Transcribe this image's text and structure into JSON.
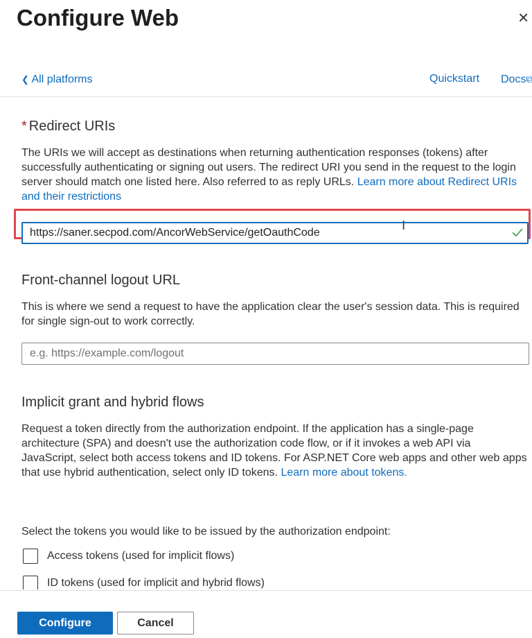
{
  "header": {
    "title": "Configure Web",
    "close_glyph": "×"
  },
  "nav": {
    "back_glyph": "❮",
    "back_label": "All platforms",
    "quickstart_label": "Quickstart",
    "docs_label": "Docs",
    "docs_icon_glyph": "⧉"
  },
  "redirect": {
    "required_marker": "*",
    "heading": "Redirect URIs",
    "description": "The URIs we will accept as destinations when returning authentication responses (tokens) after successfully authenticating or signing out users. The redirect URI you send in the request to the login server should match one listed here. Also referred to as reply URLs.",
    "learn_more": "Learn more about Redirect URIs and their restrictions",
    "uri_value": "https://saner.secpod.com/AncorWebService/getOauthCode",
    "valid_icon": "checkmark-icon",
    "cursor_glyph": "I"
  },
  "logout": {
    "heading": "Front-channel logout URL",
    "description": "This is where we send a request to have the application clear the user's session data. This is required for single sign-out to work correctly.",
    "placeholder": "e.g. https://example.com/logout"
  },
  "implicit": {
    "heading": "Implicit grant and hybrid flows",
    "description": "Request a token directly from the authorization endpoint. If the application has a single-page architecture (SPA) and doesn't use the authorization code flow, or if it invokes a web API via JavaScript, select both access tokens and ID tokens. For ASP.NET Core web apps and other web apps that use hybrid authentication, select only ID tokens.",
    "learn_more": "Learn more about tokens.",
    "select_prompt": "Select the tokens you would like to be issued by the authorization endpoint:",
    "access_tokens_label": "Access tokens (used for implicit flows)",
    "id_tokens_label": "ID tokens (used for implicit and hybrid flows)"
  },
  "footer": {
    "configure_label": "Configure",
    "cancel_label": "Cancel"
  },
  "colors": {
    "accent": "#0f6cbd",
    "highlight": "#e0474c",
    "valid": "#3c9b3c",
    "required": "#a4262c"
  }
}
